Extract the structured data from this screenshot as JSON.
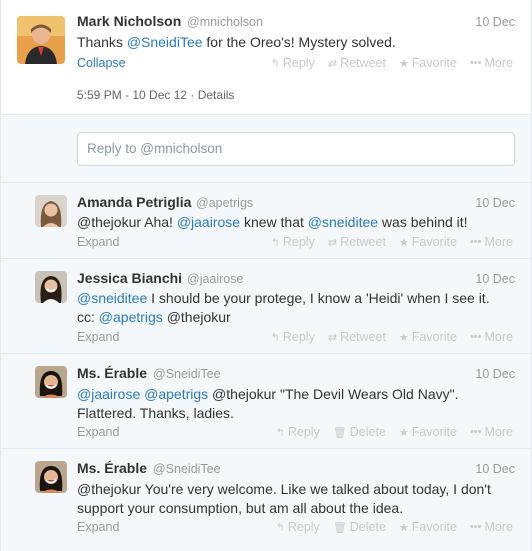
{
  "main_tweet": {
    "name": "Mark Nicholson",
    "handle": "@mnicholson",
    "date": "10 Dec",
    "text_prefix": "Thanks ",
    "mention": "@SneidiTee",
    "text_suffix": " for the Oreo's! Mystery solved.",
    "collapse": "Collapse",
    "meta": "5:59 PM - 10 Dec 12 · Details",
    "actions": {
      "reply": "Reply",
      "retweet": "Retweet",
      "favorite": "Favorite",
      "more": "More"
    }
  },
  "reply_box": {
    "placeholder": "Reply to @mnicholson"
  },
  "replies": [
    {
      "name": "Amanda Petriglia",
      "handle": "@apetrigs",
      "date": "10 Dec",
      "line1": {
        "p1": "@thejokur Aha! ",
        "m1": "@jaairose",
        "p2": " knew that ",
        "m2": "@sneiditee",
        "p3": " was behind it!"
      },
      "expand": "Expand",
      "actions": {
        "reply": "Reply",
        "retweet": "Retweet",
        "favorite": "Favorite",
        "more": "More"
      }
    },
    {
      "name": "Jessica Bianchi",
      "handle": "@jaairose",
      "date": "10 Dec",
      "line1": {
        "m1": "@sneiditee",
        "p1": " I should be your protege, I know a 'Heidi' when I see it."
      },
      "line2": {
        "p1": "cc: ",
        "m1": "@apetrigs",
        "p2": " @thejokur"
      },
      "expand": "Expand",
      "actions": {
        "reply": "Reply",
        "retweet": "Retweet",
        "favorite": "Favorite",
        "more": "More"
      }
    },
    {
      "name": "Ms. Érable",
      "handle": "@SneidiTee",
      "date": "10 Dec",
      "line1": {
        "m1": "@jaairose",
        "p1": " ",
        "m2": "@apetrigs",
        "p2": " @thejokur \"The Devil Wears Old Navy\"."
      },
      "line2": {
        "p1": "Flattered. Thanks, ladies."
      },
      "expand": "Expand",
      "actions": {
        "reply": "Reply",
        "delete": "Delete",
        "favorite": "Favorite",
        "more": "More"
      }
    },
    {
      "name": "Ms. Érable",
      "handle": "@SneidiTee",
      "date": "10 Dec",
      "line1": {
        "p1": "@thejokur You're very welcome. Like we talked about today, I don't"
      },
      "line2": {
        "p1": "support your consumption, but am all about the idea."
      },
      "expand": "Expand",
      "actions": {
        "reply": "Reply",
        "delete": "Delete",
        "favorite": "Favorite",
        "more": "More"
      }
    }
  ],
  "colors": {
    "link": "#2b7bb9",
    "muted": "#999999",
    "action": "#c9c9c9",
    "reply_bg": "#f5f8fa"
  },
  "icons": [
    "reply-icon",
    "retweet-icon",
    "favorite-star-icon",
    "more-dots-icon",
    "trash-icon"
  ]
}
